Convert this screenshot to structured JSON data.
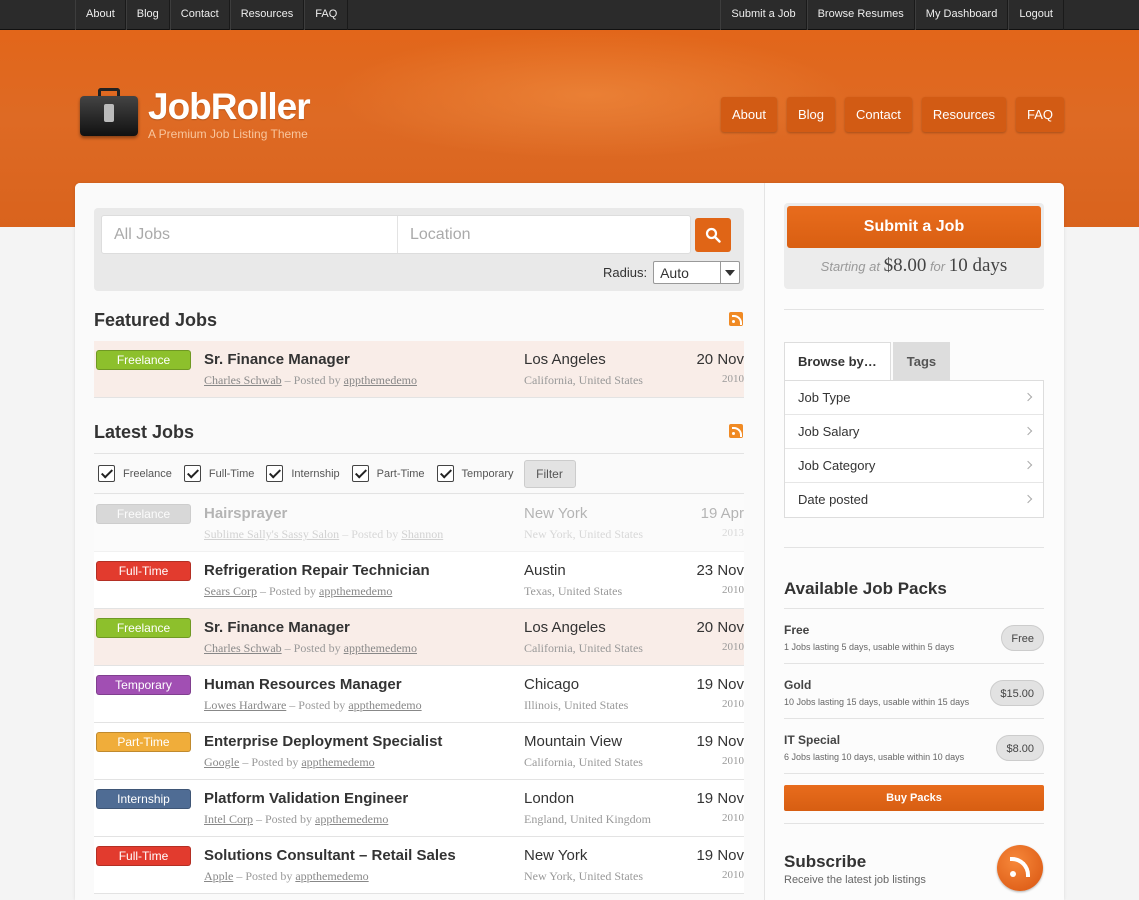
{
  "topnav": {
    "left": [
      "About",
      "Blog",
      "Contact",
      "Resources",
      "FAQ"
    ],
    "right": [
      "Submit a Job",
      "Browse Resumes",
      "My Dashboard",
      "Logout"
    ]
  },
  "header": {
    "title": "JobRoller",
    "tagline": "A Premium Job Listing Theme",
    "nav": [
      "About",
      "Blog",
      "Contact",
      "Resources",
      "FAQ"
    ]
  },
  "search": {
    "what_placeholder": "All Jobs",
    "where_placeholder": "Location",
    "radius_label": "Radius:",
    "radius_value": "Auto"
  },
  "featured": {
    "title": "Featured Jobs",
    "jobs": [
      {
        "type": "Freelance",
        "color": "#8dc02c",
        "title": "Sr. Finance Manager",
        "company": "Charles Schwab",
        "posted_sep": "– Posted by",
        "poster": "appthemedemo",
        "city": "Los Angeles",
        "region": "California, United States",
        "date": "20 Nov",
        "year": "2010"
      }
    ]
  },
  "latest": {
    "title": "Latest Jobs",
    "filters": [
      "Freelance",
      "Full-Time",
      "Internship",
      "Part-Time",
      "Temporary"
    ],
    "filter_button": "Filter",
    "jobs": [
      {
        "type": "Freelance",
        "color": "#9a9a9a",
        "title": "Hairsprayer",
        "company": "Sublime Sally's Sassy Salon",
        "posted_sep": "– Posted by",
        "poster": "Shannon",
        "city": "New York",
        "region": "New York, United States",
        "date": "19 Apr",
        "year": "2013",
        "state": "faded"
      },
      {
        "type": "Full-Time",
        "color": "#e23b2e",
        "title": "Refrigeration Repair Technician",
        "company": "Sears Corp",
        "posted_sep": "– Posted by",
        "poster": "appthemedemo",
        "city": "Austin",
        "region": "Texas, United States",
        "date": "23 Nov",
        "year": "2010",
        "state": "normal"
      },
      {
        "type": "Freelance",
        "color": "#8dc02c",
        "title": "Sr. Finance Manager",
        "company": "Charles Schwab",
        "posted_sep": "– Posted by",
        "poster": "appthemedemo",
        "city": "Los Angeles",
        "region": "California, United States",
        "date": "20 Nov",
        "year": "2010",
        "state": "featured"
      },
      {
        "type": "Temporary",
        "color": "#a14fb3",
        "title": "Human Resources Manager",
        "company": "Lowes Hardware",
        "posted_sep": "– Posted by",
        "poster": "appthemedemo",
        "city": "Chicago",
        "region": "Illinois, United States",
        "date": "19 Nov",
        "year": "2010",
        "state": "normal"
      },
      {
        "type": "Part-Time",
        "color": "#f0ad3a",
        "title": "Enterprise Deployment Specialist",
        "company": "Google",
        "posted_sep": "– Posted by",
        "poster": "appthemedemo",
        "city": "Mountain View",
        "region": "California, United States",
        "date": "19 Nov",
        "year": "2010",
        "state": "normal"
      },
      {
        "type": "Internship",
        "color": "#4f6c94",
        "title": "Platform Validation Engineer",
        "company": "Intel Corp",
        "posted_sep": "– Posted by",
        "poster": "appthemedemo",
        "city": "London",
        "region": "England, United Kingdom",
        "date": "19 Nov",
        "year": "2010",
        "state": "normal"
      },
      {
        "type": "Full-Time",
        "color": "#e23b2e",
        "title": "Solutions Consultant – Retail Sales",
        "company": "Apple",
        "posted_sep": "– Posted by",
        "poster": "appthemedemo",
        "city": "New York",
        "region": "New York, United States",
        "date": "19 Nov",
        "year": "2010",
        "state": "normal"
      }
    ]
  },
  "sidebar": {
    "submit_label": "Submit a Job",
    "price_prefix": "Starting at",
    "price": "$8.00",
    "price_mid": "for",
    "price_duration": "10 days",
    "tabs": [
      "Browse by…",
      "Tags"
    ],
    "browse_items": [
      "Job Type",
      "Job Salary",
      "Job Category",
      "Date posted"
    ],
    "packs_title": "Available Job Packs",
    "packs": [
      {
        "name": "Free",
        "desc": "1 Jobs lasting 5 days, usable within 5 days",
        "price": "Free"
      },
      {
        "name": "Gold",
        "desc": "10 Jobs lasting 15 days, usable within 15 days",
        "price": "$15.00"
      },
      {
        "name": "IT Special",
        "desc": "6 Jobs lasting 10 days, usable within 10 days",
        "price": "$8.00"
      }
    ],
    "buy_label": "Buy Packs",
    "subscribe_title": "Subscribe",
    "subscribe_desc": "Receive the latest job listings"
  },
  "colors": {
    "brand": "#e06516",
    "topbar": "#2b2b2b"
  }
}
